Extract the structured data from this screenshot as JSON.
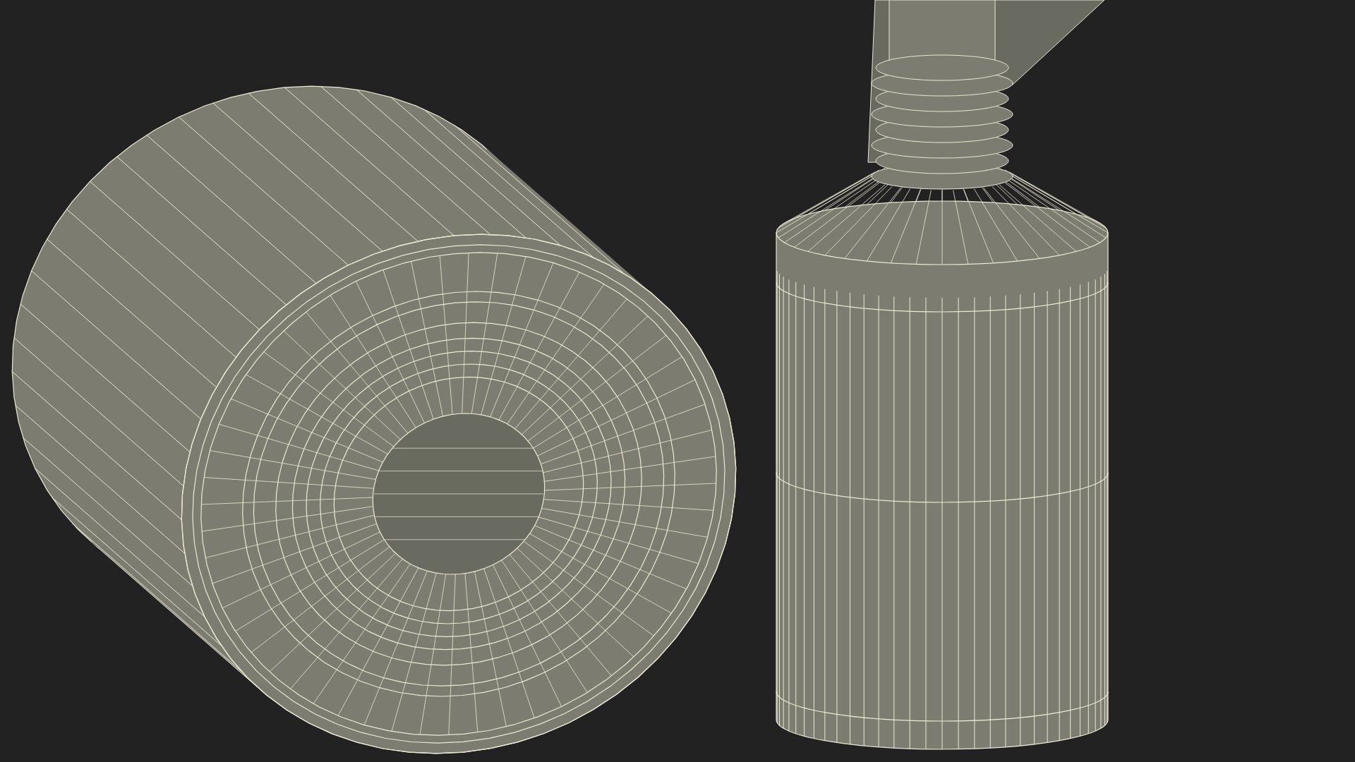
{
  "viewport": {
    "objects": [
      {
        "kind": "cap"
      },
      {
        "kind": "bottle"
      }
    ]
  }
}
